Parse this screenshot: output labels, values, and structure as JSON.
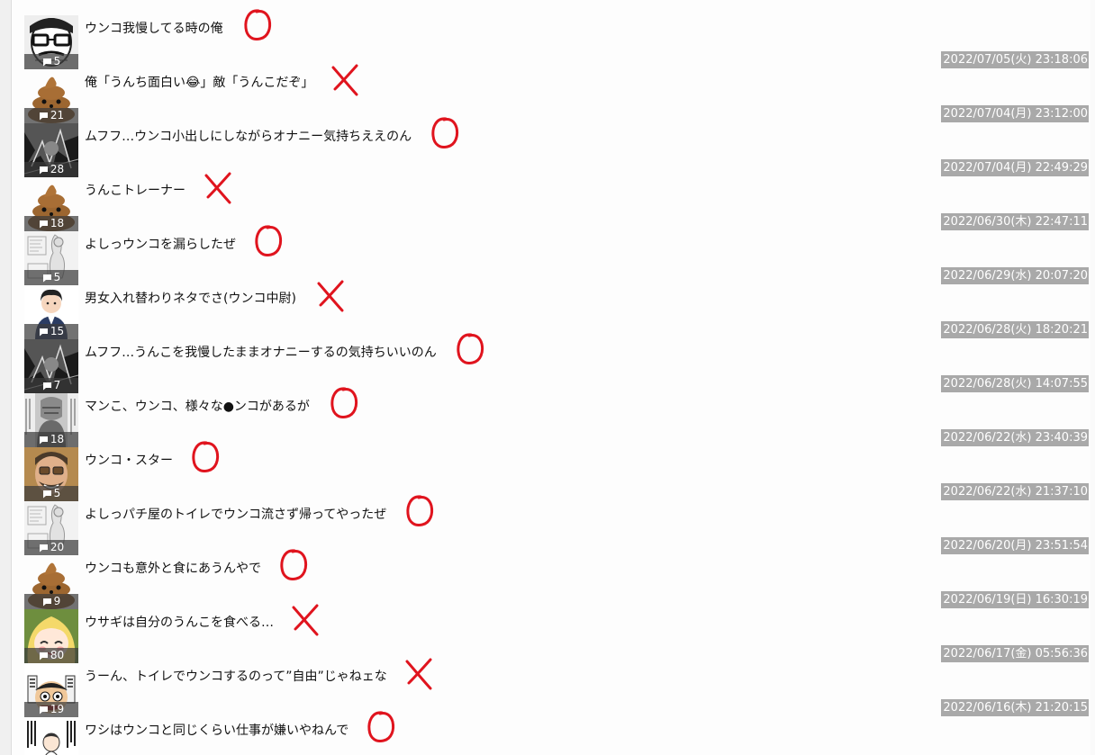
{
  "threads": [
    {
      "title": "ウンコ我慢してる時の俺",
      "comments": "5",
      "date": "2022/07/05(火) 23:18:06",
      "thumb": "manga-glasses",
      "mark": "circle"
    },
    {
      "title": "俺「うんち面白い😂」敵「うんこだぞ」",
      "comments": "21",
      "date": "2022/07/04(月) 23:12:00",
      "thumb": "poop",
      "mark": "cross"
    },
    {
      "title": "ムフフ…ウンコ小出しにしながらオナニー気持ちええのん",
      "comments": "28",
      "date": "2022/07/04(月) 22:49:29",
      "thumb": "dark-manga",
      "mark": "circle"
    },
    {
      "title": "うんこトレーナー",
      "comments": "18",
      "date": "2022/06/30(木) 22:47:11",
      "thumb": "poop",
      "mark": "cross"
    },
    {
      "title": "よしっウンコを漏らしたぜ",
      "comments": "5",
      "date": "2022/06/29(水) 20:07:20",
      "thumb": "light-manga",
      "mark": "circle"
    },
    {
      "title": "男女入れ替わりネタでさ(ウンコ中尉)",
      "comments": "15",
      "date": "2022/06/28(火) 18:20:21",
      "thumb": "suit-woman",
      "mark": "cross"
    },
    {
      "title": "ムフフ…うんこを我慢したままオナニーするの気持ちいいのん",
      "comments": "7",
      "date": "2022/06/28(火) 14:07:55",
      "thumb": "dark-manga",
      "mark": "circle"
    },
    {
      "title": "マンこ、ウンコ、様々な●ンコがあるが",
      "comments": "18",
      "date": "2022/06/22(水) 23:40:39",
      "thumb": "gray-manga",
      "mark": "circle"
    },
    {
      "title": "ウンコ・スター",
      "comments": "5",
      "date": "2022/06/22(水) 21:37:10",
      "thumb": "photo-face",
      "mark": "circle"
    },
    {
      "title": "よしっパチ屋のトイレでウンコ流さず帰ってやったぜ",
      "comments": "20",
      "date": "2022/06/20(月) 23:51:54",
      "thumb": "light-manga",
      "mark": "circle"
    },
    {
      "title": "ウンコも意外と食にあうんやで",
      "comments": "9",
      "date": "2022/06/19(日) 16:30:19",
      "thumb": "poop",
      "mark": "circle"
    },
    {
      "title": "ウサギは自分のうんこを食べる…",
      "comments": "80",
      "date": "2022/06/17(金) 05:56:36",
      "thumb": "anime-girl",
      "mark": "cross"
    },
    {
      "title": "うーん、トイレでウンコするのって”自由”じゃねェな",
      "comments": "19",
      "date": "2022/06/16(木) 21:20:15",
      "thumb": "luffy",
      "mark": "cross"
    },
    {
      "title": "ワシはウンコと同じくらい仕事が嫌いやねんで",
      "comments": "",
      "date": "",
      "thumb": "text-manga",
      "mark": "circle"
    }
  ],
  "colors": {
    "date_bg": "#a9a9a9",
    "badge_bg": "#3c3c3c",
    "mark": "#e0141e"
  },
  "icons": {
    "comment": "comment-icon"
  }
}
